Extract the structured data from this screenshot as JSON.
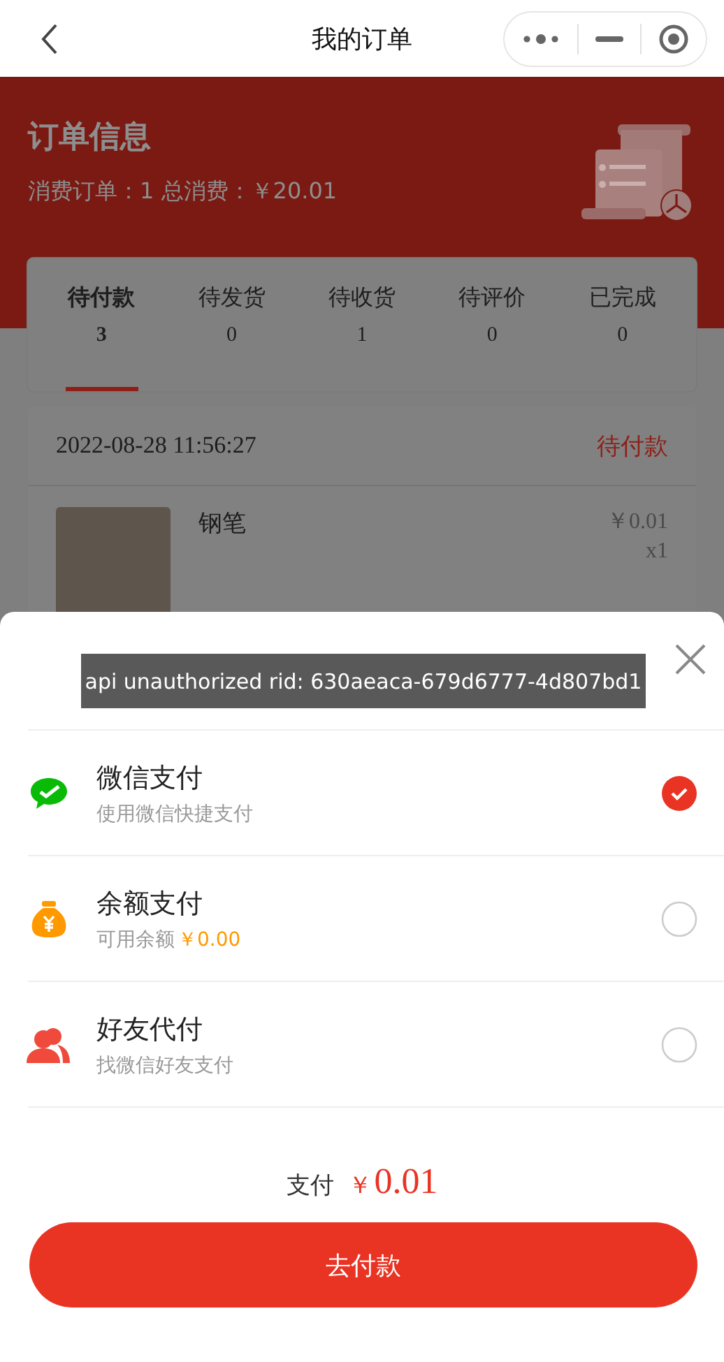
{
  "nav": {
    "title": "我的订单"
  },
  "header": {
    "title": "订单信息",
    "summary": "消费订单：1 总消费：￥20.01"
  },
  "tabs": [
    {
      "label": "待付款",
      "count": "3",
      "selected": true
    },
    {
      "label": "待发货",
      "count": "0",
      "selected": false
    },
    {
      "label": "待收货",
      "count": "1",
      "selected": false
    },
    {
      "label": "待评价",
      "count": "0",
      "selected": false
    },
    {
      "label": "已完成",
      "count": "0",
      "selected": false
    }
  ],
  "order": {
    "time": "2022-08-28 11:56:27",
    "status": "待付款",
    "items": [
      {
        "name": "钢笔",
        "price": "￥0.01",
        "quantity": "x1"
      }
    ]
  },
  "toast": "api unauthorized rid: 630aeaca-679d6777-4d807bd1",
  "payment_methods": [
    {
      "kind": "wechat",
      "title": "微信支付",
      "subtitle": "使用微信快捷支付",
      "selected": true
    },
    {
      "kind": "balance",
      "title": "余额支付",
      "subtitle": "可用余额",
      "balance": "￥0.00",
      "selected": false
    },
    {
      "kind": "friend",
      "title": "好友代付",
      "subtitle": "找微信好友支付",
      "selected": false
    }
  ],
  "total": {
    "label": "支付",
    "currency": "￥",
    "amount": "0.01"
  },
  "submit_button": "去付款"
}
